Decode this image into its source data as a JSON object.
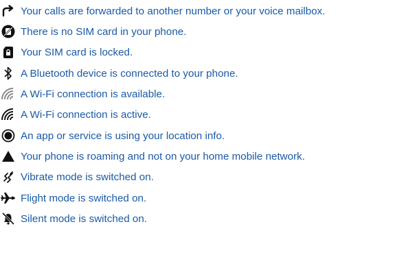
{
  "colors": {
    "text": "#1a5aa6",
    "icon": "#111111",
    "icon_muted": "#8a8a8a"
  },
  "items": [
    {
      "icon": "call-forward-icon",
      "text": "Your calls are forwarded to another number or your voice mailbox."
    },
    {
      "icon": "no-sim-icon",
      "text": "There is no SIM card in your phone."
    },
    {
      "icon": "sim-locked-icon",
      "text": "Your SIM card is locked."
    },
    {
      "icon": "bluetooth-icon",
      "text": "A Bluetooth device is connected to your phone."
    },
    {
      "icon": "wifi-available-icon",
      "text": "A Wi-Fi connection is available."
    },
    {
      "icon": "wifi-active-icon",
      "text": "A Wi-Fi connection is active."
    },
    {
      "icon": "location-icon",
      "text": "An app or service is using your location info."
    },
    {
      "icon": "roaming-icon",
      "text": "Your phone is roaming and not on your home mobile network."
    },
    {
      "icon": "vibrate-icon",
      "text": "Vibrate mode is switched on."
    },
    {
      "icon": "flight-mode-icon",
      "text": "Flight mode is switched on."
    },
    {
      "icon": "silent-mode-icon",
      "text": "Silent mode is switched on."
    }
  ]
}
